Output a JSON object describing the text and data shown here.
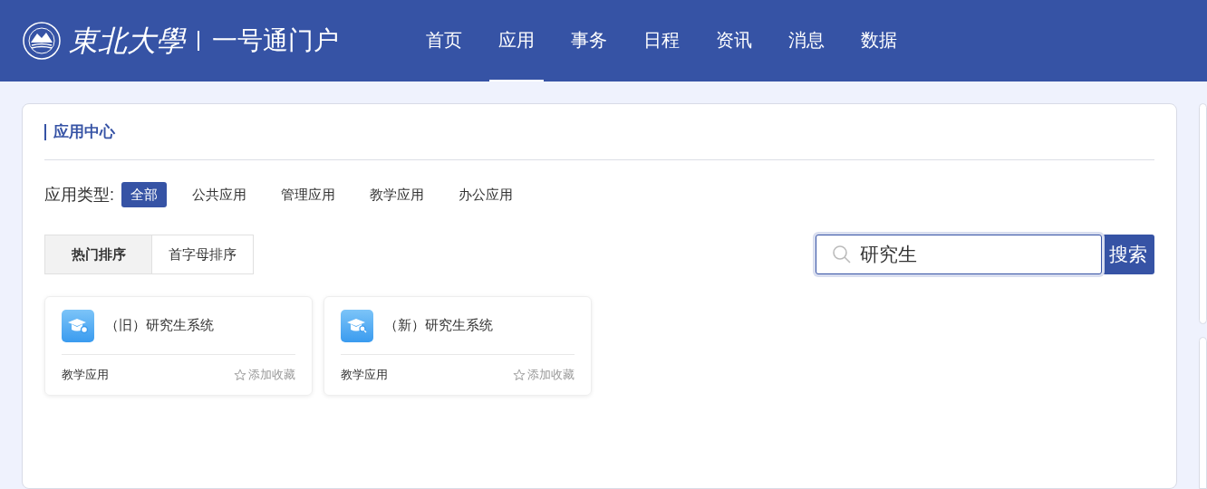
{
  "header": {
    "logo_text": "東北大學",
    "title": "一号通门户",
    "nav": [
      {
        "label": "首页",
        "selected": false
      },
      {
        "label": "应用",
        "selected": true
      },
      {
        "label": "事务",
        "selected": false
      },
      {
        "label": "日程",
        "selected": false
      },
      {
        "label": "资讯",
        "selected": false
      },
      {
        "label": "消息",
        "selected": false
      },
      {
        "label": "数据",
        "selected": false
      }
    ]
  },
  "app_center": {
    "title": "应用中心",
    "filter_label": "应用类型:",
    "types": [
      {
        "label": "全部",
        "selected": true
      },
      {
        "label": "公共应用",
        "selected": false
      },
      {
        "label": "管理应用",
        "selected": false
      },
      {
        "label": "教学应用",
        "selected": false
      },
      {
        "label": "办公应用",
        "selected": false
      }
    ],
    "sort_tabs": [
      {
        "label": "热门排序",
        "selected": true
      },
      {
        "label": "首字母排序",
        "selected": false
      }
    ],
    "search": {
      "value": "研究生",
      "button": "搜索"
    },
    "apps": [
      {
        "name": "（旧）研究生系统",
        "category": "教学应用",
        "favorite": "添加收藏",
        "kind": "gear"
      },
      {
        "name": "（新）研究生系统",
        "category": "教学应用",
        "favorite": "添加收藏",
        "kind": "search"
      }
    ]
  }
}
